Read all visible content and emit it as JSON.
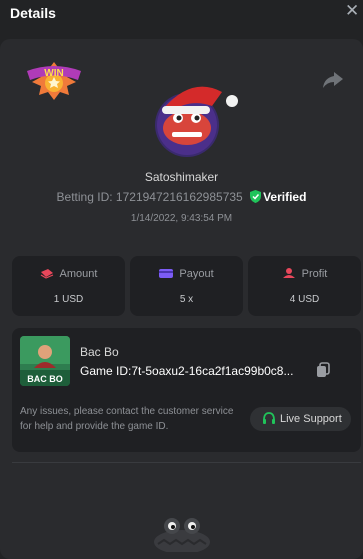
{
  "header": {
    "title": "Details",
    "close_icon": "close-icon"
  },
  "profile": {
    "badge_text": "WIN",
    "username": "Satoshimaker",
    "betting_id_label": "Betting ID:",
    "betting_id": "1721947216162985735",
    "verified_label": "Verified",
    "date": "1/14/2022, 9:43:54 PM"
  },
  "stats": [
    {
      "label": "Amount",
      "value": "1 USD",
      "icon": "amount-icon",
      "color": "#e8475b"
    },
    {
      "label": "Payout",
      "value": "5 x",
      "icon": "payout-icon",
      "color": "#7c5cf5"
    },
    {
      "label": "Profit",
      "value": "4 USD",
      "icon": "profit-icon",
      "color": "#e8475b"
    }
  ],
  "game": {
    "thumb_text": "BAC BO",
    "name": "Bac Bo",
    "id_text": "Game ID:7t-5oaxu2-16ca2f1ac99b0c8...",
    "issue_text": "Any issues, please contact the customer service for help and provide the game ID.",
    "support_label": "Live Support"
  },
  "colors": {
    "verified": "#20c45a",
    "background": "#222325",
    "card": "#2a2b2e"
  }
}
